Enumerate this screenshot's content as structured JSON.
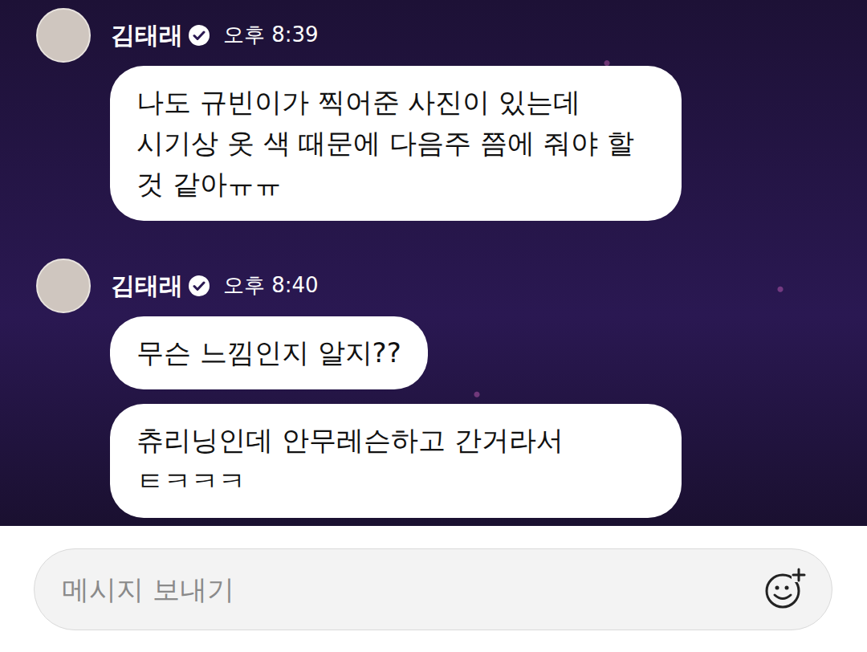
{
  "groups": [
    {
      "sender": "김태래",
      "verified": true,
      "time": "오후 8:39",
      "bubbles": [
        "나도 규빈이가 찍어준 사진이 있는데 시기상 옷 색 때문에 다음주 쯤에 줘야 할 것 같아ㅠㅠ"
      ]
    },
    {
      "sender": "김태래",
      "verified": true,
      "time": "오후 8:40",
      "bubbles": [
        "무슨 느낌인지 알지??",
        "츄리닝인데 안무레슨하고 간거라서 ㅌㅋㅋㅋ"
      ]
    }
  ],
  "compose": {
    "placeholder": "메시지 보내기"
  }
}
